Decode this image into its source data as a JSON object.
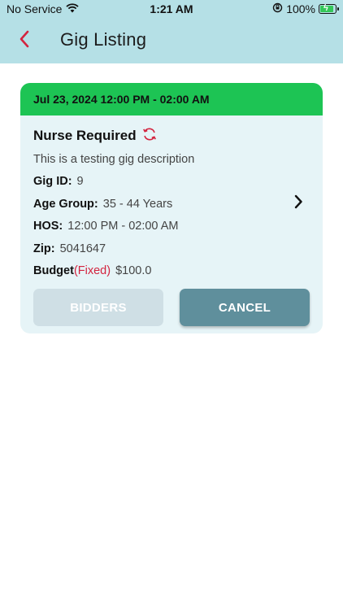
{
  "status_bar": {
    "carrier": "No Service",
    "time": "1:21 AM",
    "battery_percent": "100%",
    "icons": [
      "wifi-icon",
      "orientation-lock-icon",
      "battery-charging-icon"
    ]
  },
  "header": {
    "title": "Gig Listing",
    "back_icon": "chevron-left-icon",
    "background_color": "#b5e0e6",
    "accent_color": "#d3243f"
  },
  "gig": {
    "datetime": "Jul 23, 2024 12:00 PM - 02:00 AM",
    "header_color": "#1dc454",
    "title": "Nurse Required",
    "title_icon": "refresh-icon",
    "description": "This is a testing gig description",
    "gig_id_label": "Gig ID:",
    "gig_id": "9",
    "age_group_label": "Age Group:",
    "age_group": "35 - 44 Years",
    "hos_label": "HOS:",
    "hos": "12:00 PM - 02:00 AM",
    "zip_label": "Zip:",
    "zip": "5041647",
    "budget_label": "Budget",
    "budget_type": "(Fixed)",
    "budget": "$100.0",
    "detail_icon": "chevron-right-icon"
  },
  "actions": {
    "bidders_label": "BIDDERS",
    "cancel_label": "CANCEL"
  }
}
